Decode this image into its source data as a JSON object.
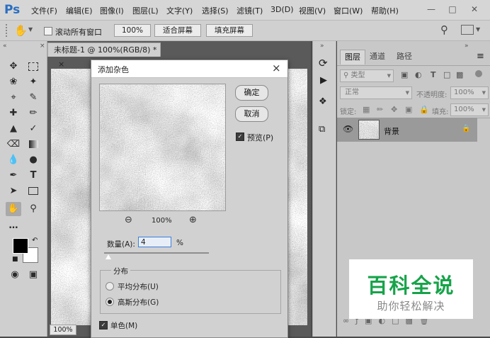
{
  "app": {
    "logo": "Ps",
    "menu": [
      "文件(F)",
      "编辑(E)",
      "图像(I)",
      "图层(L)",
      "文字(Y)",
      "选择(S)",
      "滤镜(T)",
      "3D(D)",
      "视图(V)",
      "窗口(W)",
      "帮助(H)"
    ]
  },
  "options": {
    "scroll_all_label": "滚动所有窗口",
    "zoom_value": "100%",
    "fit_screen": "适合屏幕",
    "fill_screen": "填充屏幕"
  },
  "document": {
    "tab_title": "未标题-1 @ 100%(RGB/8) *",
    "tab_close": "×",
    "zoom_status": "100%"
  },
  "layers_panel": {
    "tabs": [
      "图层",
      "通道",
      "路径"
    ],
    "filter_kind": "类型",
    "blend_mode": "正常",
    "opacity_label": "不透明度:",
    "opacity_value": "100%",
    "lock_label": "锁定:",
    "fill_label": "填充:",
    "fill_value": "100%",
    "layer_name": "背景"
  },
  "dialog": {
    "title": "添加杂色",
    "close": "×",
    "ok": "确定",
    "cancel": "取消",
    "preview_label": "预览(P)",
    "preview_zoom": "100%",
    "amount_label": "数量(A):",
    "amount_value": "4",
    "amount_unit": "%",
    "amount_fraction": 0.04,
    "distribution_label": "分布",
    "uniform_label": "平均分布(U)",
    "gaussian_label": "高斯分布(G)",
    "mono_label": "单色(M)"
  },
  "watermark": {
    "title": "百科全说",
    "subtitle": "助你轻松解决"
  },
  "colors": {
    "brand_blue": "#2a6ec2",
    "dialog_border": "#8a8a8a",
    "watermark_green": "#17a34a"
  }
}
